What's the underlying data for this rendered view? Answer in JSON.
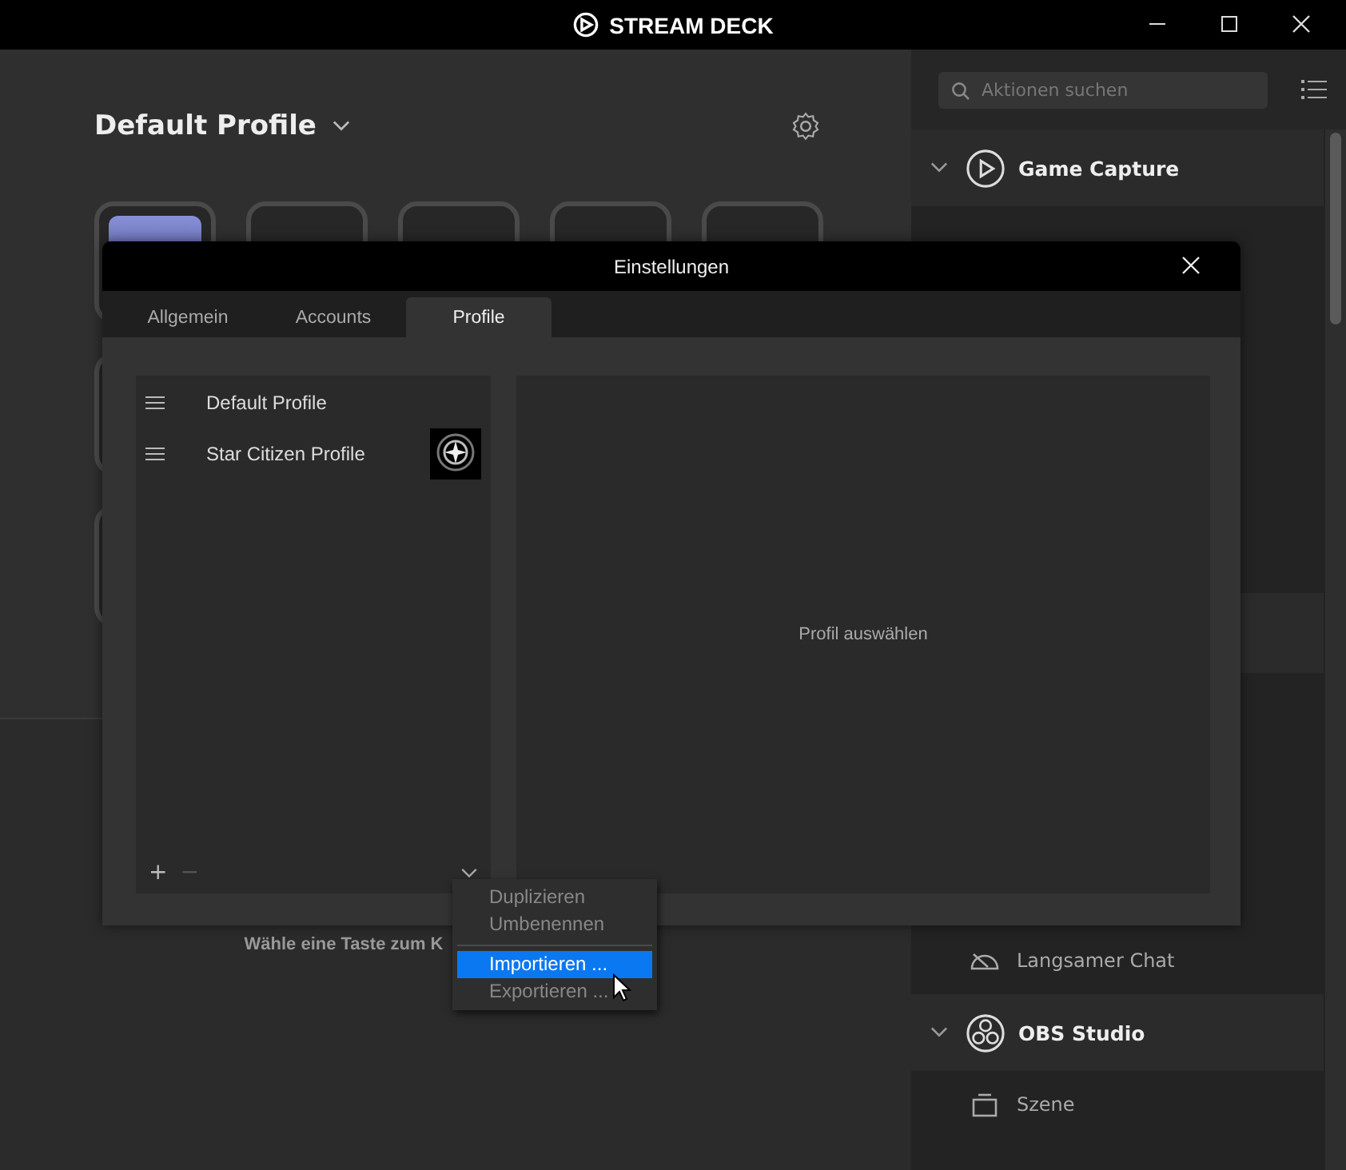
{
  "window": {
    "title": "STREAM DECK"
  },
  "profile": {
    "name": "Default Profile"
  },
  "hint": "Wähle eine Taste zum K",
  "sidebar": {
    "search": {
      "placeholder": "Aktionen suchen"
    },
    "groups": [
      {
        "name": "Game Capture",
        "expanded": true
      },
      {
        "name": "OBS Studio",
        "expanded": true,
        "before": [
          {
            "label": "Langsamer Chat"
          }
        ],
        "items": [
          {
            "label": "Szene"
          }
        ]
      }
    ]
  },
  "dialog": {
    "title": "Einstellungen",
    "tabs": [
      {
        "label": "Allgemein",
        "selected": false
      },
      {
        "label": "Accounts",
        "selected": false
      },
      {
        "label": "Profile",
        "selected": true
      }
    ],
    "profiles": [
      {
        "name": "Default Profile",
        "has_icon": false
      },
      {
        "name": "Star Citizen Profile",
        "has_icon": true
      }
    ],
    "add": "+",
    "remove": "−",
    "empty_text": "Profil auswählen",
    "menu": [
      {
        "label": "Duplizieren",
        "selected": false,
        "disabled": true
      },
      {
        "label": "Umbenennen",
        "selected": false,
        "disabled": true
      },
      {
        "kind": "separator"
      },
      {
        "label": "Importieren ...",
        "selected": true,
        "disabled": false
      },
      {
        "label": "Exportieren ...",
        "selected": false,
        "disabled": true
      }
    ]
  }
}
